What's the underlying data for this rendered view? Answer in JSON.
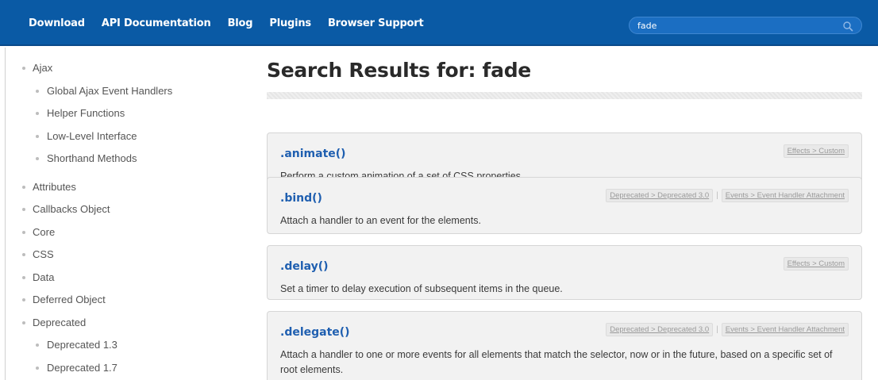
{
  "nav": {
    "items": [
      "Download",
      "API Documentation",
      "Blog",
      "Plugins",
      "Browser Support"
    ]
  },
  "search": {
    "value": "fade",
    "icon": "search-icon"
  },
  "sidebar": {
    "items": [
      {
        "label": "Ajax",
        "level": 0
      },
      {
        "label": "Global Ajax Event Handlers",
        "level": 1
      },
      {
        "label": "Helper Functions",
        "level": 1
      },
      {
        "label": "Low-Level Interface",
        "level": 1
      },
      {
        "label": "Shorthand Methods",
        "level": 1
      },
      {
        "label": "Attributes",
        "level": 0
      },
      {
        "label": "Callbacks Object",
        "level": 0
      },
      {
        "label": "Core",
        "level": 0
      },
      {
        "label": "CSS",
        "level": 0
      },
      {
        "label": "Data",
        "level": 0
      },
      {
        "label": "Deferred Object",
        "level": 0
      },
      {
        "label": "Deprecated",
        "level": 0
      },
      {
        "label": "Deprecated 1.3",
        "level": 1
      },
      {
        "label": "Deprecated 1.7",
        "level": 1
      }
    ]
  },
  "main": {
    "title": "Search Results for: fade",
    "results": [
      {
        "title": ".animate()",
        "description": "Perform a custom animation of a set of CSS properties.",
        "categories": [
          "Effects > Custom"
        ]
      },
      {
        "title": ".bind()",
        "description": "Attach a handler to an event for the elements.",
        "categories": [
          "Deprecated > Deprecated 3.0",
          "Events > Event Handler Attachment"
        ]
      },
      {
        "title": ".delay()",
        "description": "Set a timer to delay execution of subsequent items in the queue.",
        "categories": [
          "Effects > Custom"
        ]
      },
      {
        "title": ".delegate()",
        "description": "Attach a handler to one or more events for all elements that match the selector, now or in the future, based on a specific set of root elements.",
        "categories": [
          "Deprecated > Deprecated 3.0",
          "Events > Event Handler Attachment"
        ]
      }
    ]
  },
  "colors": {
    "topbar": "#0a5aa5",
    "link": "#1f5fb0",
    "card_bg": "#f2f2f2"
  }
}
